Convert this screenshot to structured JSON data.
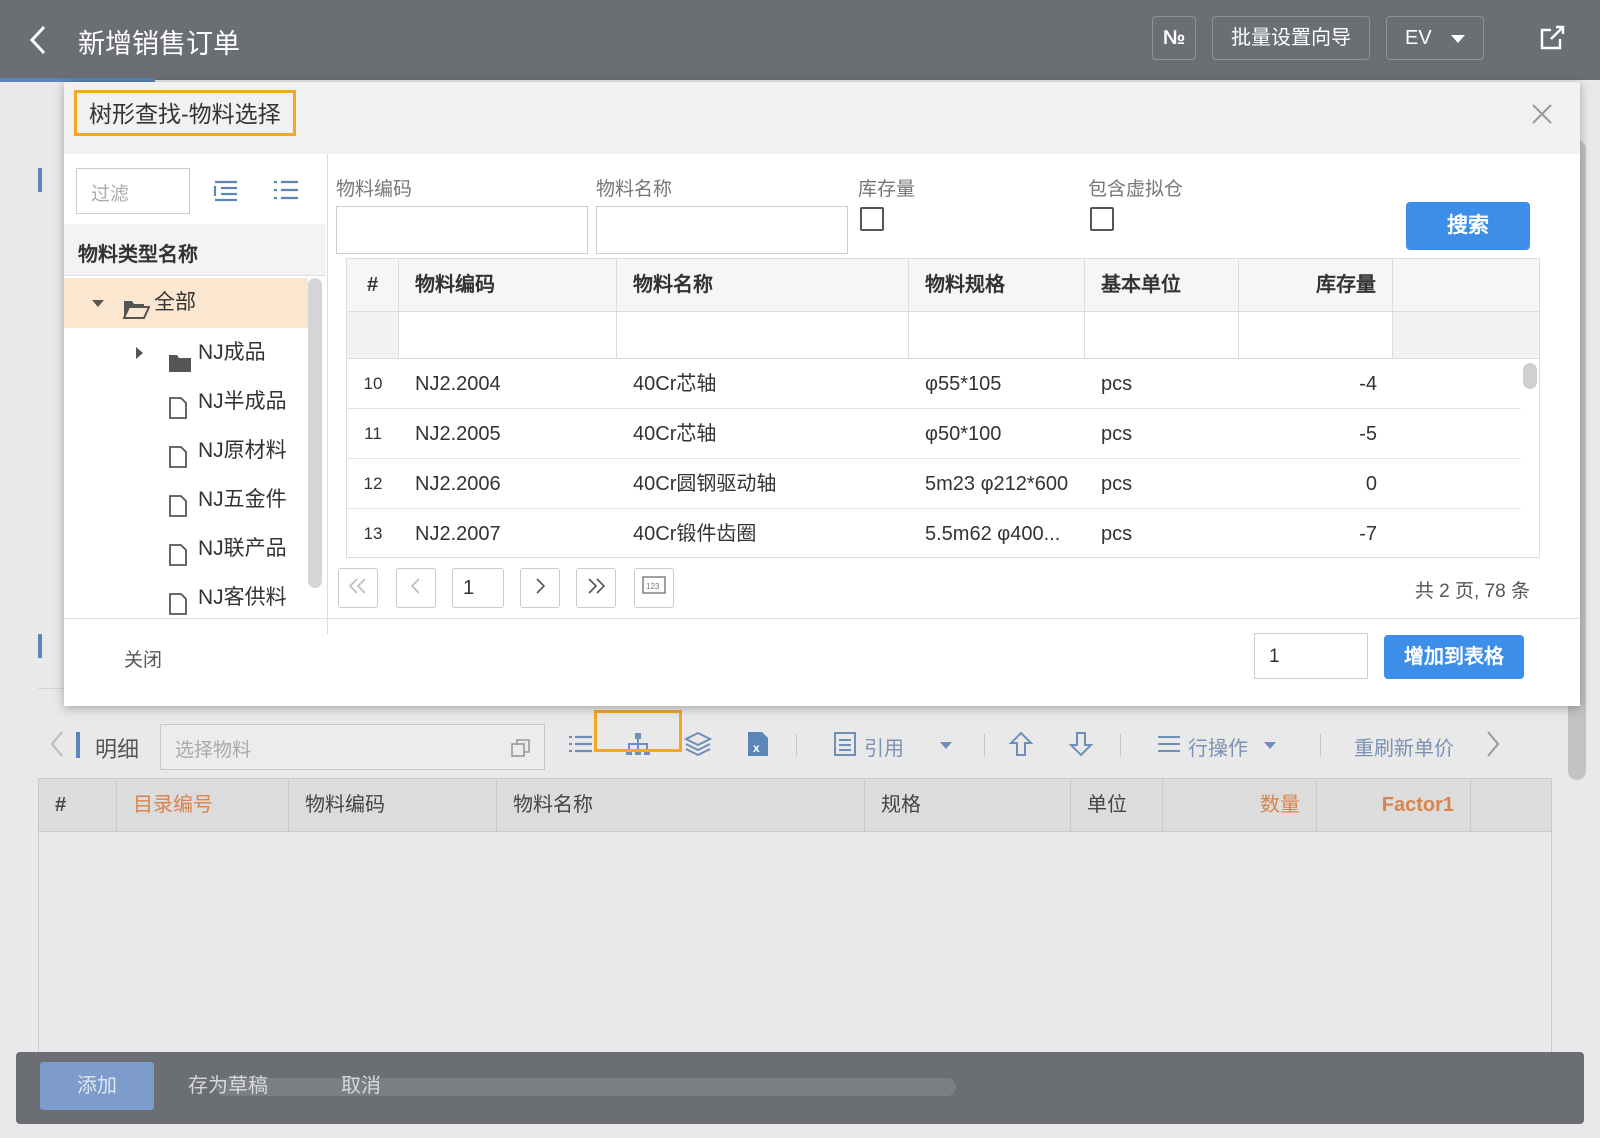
{
  "header": {
    "back_icon": "chevron-left-icon",
    "title": "新增销售订单",
    "no_button": "№",
    "batch_wizard": "批量设置向导",
    "ev_button": "EV",
    "export_icon": "share-icon"
  },
  "detail_toolbar": {
    "label": "明细",
    "select_placeholder": "选择物料",
    "ref_label": "引用",
    "row_ops_label": "行操作",
    "refresh_price": "重刷新单价"
  },
  "detail_grid": {
    "columns": [
      "#",
      "目录编号",
      "物料编码",
      "物料名称",
      "规格",
      "单位",
      "数量",
      "Factor1"
    ]
  },
  "footer": {
    "add": "添加",
    "save_draft": "存为草稿",
    "cancel": "取消"
  },
  "modal": {
    "title": "树形查找-物料选择",
    "filter_placeholder": "过滤",
    "tree_header": "物料类型名称",
    "tree": [
      "全部",
      "NJ成品",
      "NJ半成品",
      "NJ原材料",
      "NJ五金件",
      "NJ联产品",
      "NJ客供料"
    ],
    "filters": {
      "code_label": "物料编码",
      "name_label": "物料名称",
      "stock_label": "库存量",
      "virtual_label": "包含虚拟仓",
      "search_button": "搜索"
    },
    "table": {
      "columns": [
        "#",
        "物料编码",
        "物料名称",
        "物料规格",
        "基本单位",
        "库存量"
      ],
      "rows": [
        {
          "num": "10",
          "code": "NJ2.2004",
          "name": "40Cr芯轴",
          "spec": "φ55*105",
          "unit": "pcs",
          "stock": "-4"
        },
        {
          "num": "11",
          "code": "NJ2.2005",
          "name": "40Cr芯轴",
          "spec": "φ50*100",
          "unit": "pcs",
          "stock": "-5"
        },
        {
          "num": "12",
          "code": "NJ2.2006",
          "name": "40Cr圆钢驱动轴",
          "spec": "5m23 φ212*600",
          "unit": "pcs",
          "stock": "0"
        },
        {
          "num": "13",
          "code": "NJ2.2007",
          "name": "40Cr锻件齿圈",
          "spec": "5.5m62 φ400...",
          "unit": "pcs",
          "stock": "-7"
        }
      ]
    },
    "pager": {
      "page": "1",
      "summary": "共 2 页, 78 条"
    },
    "close_label": "关闭",
    "qty_value": "1",
    "add_to_table": "增加到表格"
  }
}
